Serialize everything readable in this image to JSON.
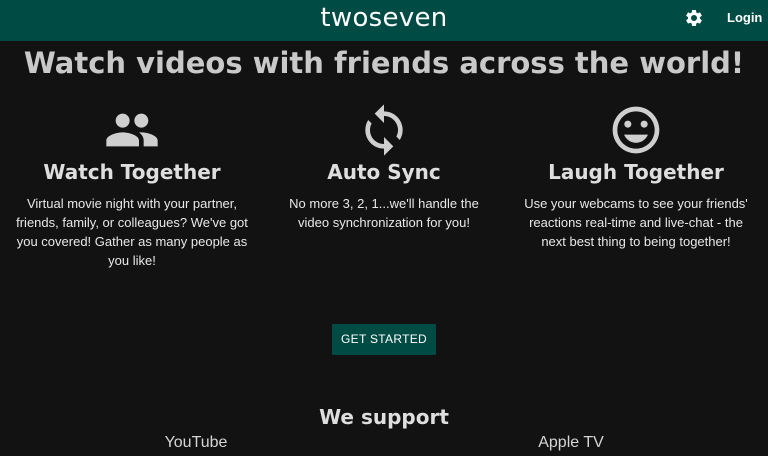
{
  "header": {
    "brand": "twoseven",
    "login_label": "Login",
    "settings_icon": "gear-icon",
    "background_color": "#004c44"
  },
  "hero": {
    "headline": "Watch videos with friends across the world!"
  },
  "features": [
    {
      "icon": "people-icon",
      "title": "Watch Together",
      "description": "Virtual movie night with your partner, friends, family, or colleagues? We've got you covered! Gather as many people as you like!"
    },
    {
      "icon": "sync-icon",
      "title": "Auto Sync",
      "description": "No more 3, 2, 1...we'll handle the video synchronization for you!"
    },
    {
      "icon": "smiley-icon",
      "title": "Laugh Together",
      "description": "Use your webcams to see your friends' reactions real-time and live-chat - the next best thing to being together!"
    }
  ],
  "cta": {
    "label": "GET STARTED"
  },
  "support": {
    "title": "We support",
    "platforms": [
      "YouTube",
      "Apple TV"
    ]
  },
  "colors": {
    "accent": "#004c44",
    "background": "#121212",
    "text": "#ececec"
  }
}
